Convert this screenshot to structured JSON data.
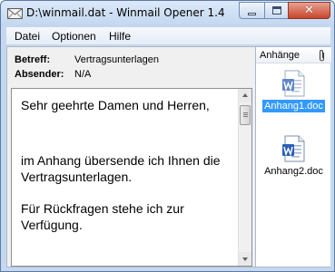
{
  "window": {
    "title": "D:\\winmail.dat - Winmail Opener 1.4",
    "icons": {
      "app": "envelope-icon",
      "minimize": "minimize-icon",
      "maximize": "maximize-icon",
      "close": "close-icon"
    },
    "close_color": "#c7462b"
  },
  "menu": {
    "items": [
      {
        "label": "Datei"
      },
      {
        "label": "Optionen"
      },
      {
        "label": "Hilfe"
      }
    ]
  },
  "header": {
    "subject_label": "Betreff:",
    "subject_value": "Vertragsunterlagen",
    "sender_label": "Absender:",
    "sender_value": "N/A"
  },
  "message": {
    "lines": [
      "Sehr geehrte Damen und Herren,",
      "im Anhang übersende ich Ihnen die Vertragsunterlagen.",
      "Für Rückfragen stehe ich zur Verfügung."
    ]
  },
  "attachments": {
    "title": "Anhänge",
    "icon": "paperclip-icon",
    "items": [
      {
        "name": "Anhang1.doc",
        "icon": "word-document-icon",
        "selected": true
      },
      {
        "name": "Anhang2.doc",
        "icon": "word-document-icon",
        "selected": false
      }
    ],
    "selection_color": "#3399ff"
  }
}
